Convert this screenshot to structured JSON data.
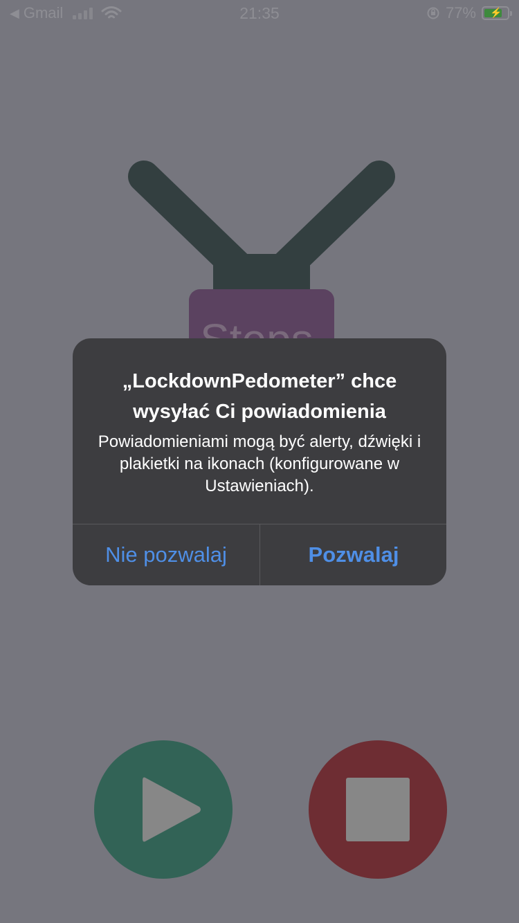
{
  "status_bar": {
    "back_app": "Gmail",
    "time": "21:35",
    "battery_percent": "77%",
    "battery_level": 0.77,
    "icons": [
      "back-arrow-icon",
      "cellular-signal-icon",
      "wifi-icon",
      "orientation-lock-icon",
      "battery-icon"
    ]
  },
  "app": {
    "badge_text": "Steps",
    "play_icon": "play-icon",
    "stop_icon": "stop-icon",
    "colors": {
      "play_button": "#326356",
      "stop_button": "#6e2d33",
      "badge": "#5b4260",
      "lanyard": "#333f40"
    }
  },
  "alert": {
    "title": "„LockdownPedometer” chce wysyłać Ci powiadomienia",
    "message": "Powiadomieniami mogą być alerty, dźwięki i plakietki na ikonach (konfigurowane w Ustawieniach).",
    "deny_label": "Nie pozwalaj",
    "allow_label": "Pozwalaj",
    "accent": "#4f8fe6"
  }
}
